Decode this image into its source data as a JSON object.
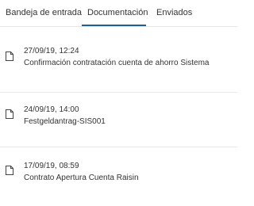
{
  "tabs": {
    "inbox_label": "Bandeja de entrada",
    "documents_label": "Documentación",
    "sent_label": "Enviados",
    "active": "Documentación",
    "active_color": "#1f5f98"
  },
  "documents": [
    {
      "icon": "document-icon",
      "date": "27/09/19, 12:24",
      "title": "Confirmación contratación cuenta de ahorro Sistema"
    },
    {
      "icon": "document-icon",
      "date": "24/09/19, 14:00",
      "title": "Festgeldantrag-SIS001"
    },
    {
      "icon": "document-icon",
      "date": "17/09/19, 08:59",
      "title": "Contrato Apertura Cuenta Raisin"
    }
  ]
}
